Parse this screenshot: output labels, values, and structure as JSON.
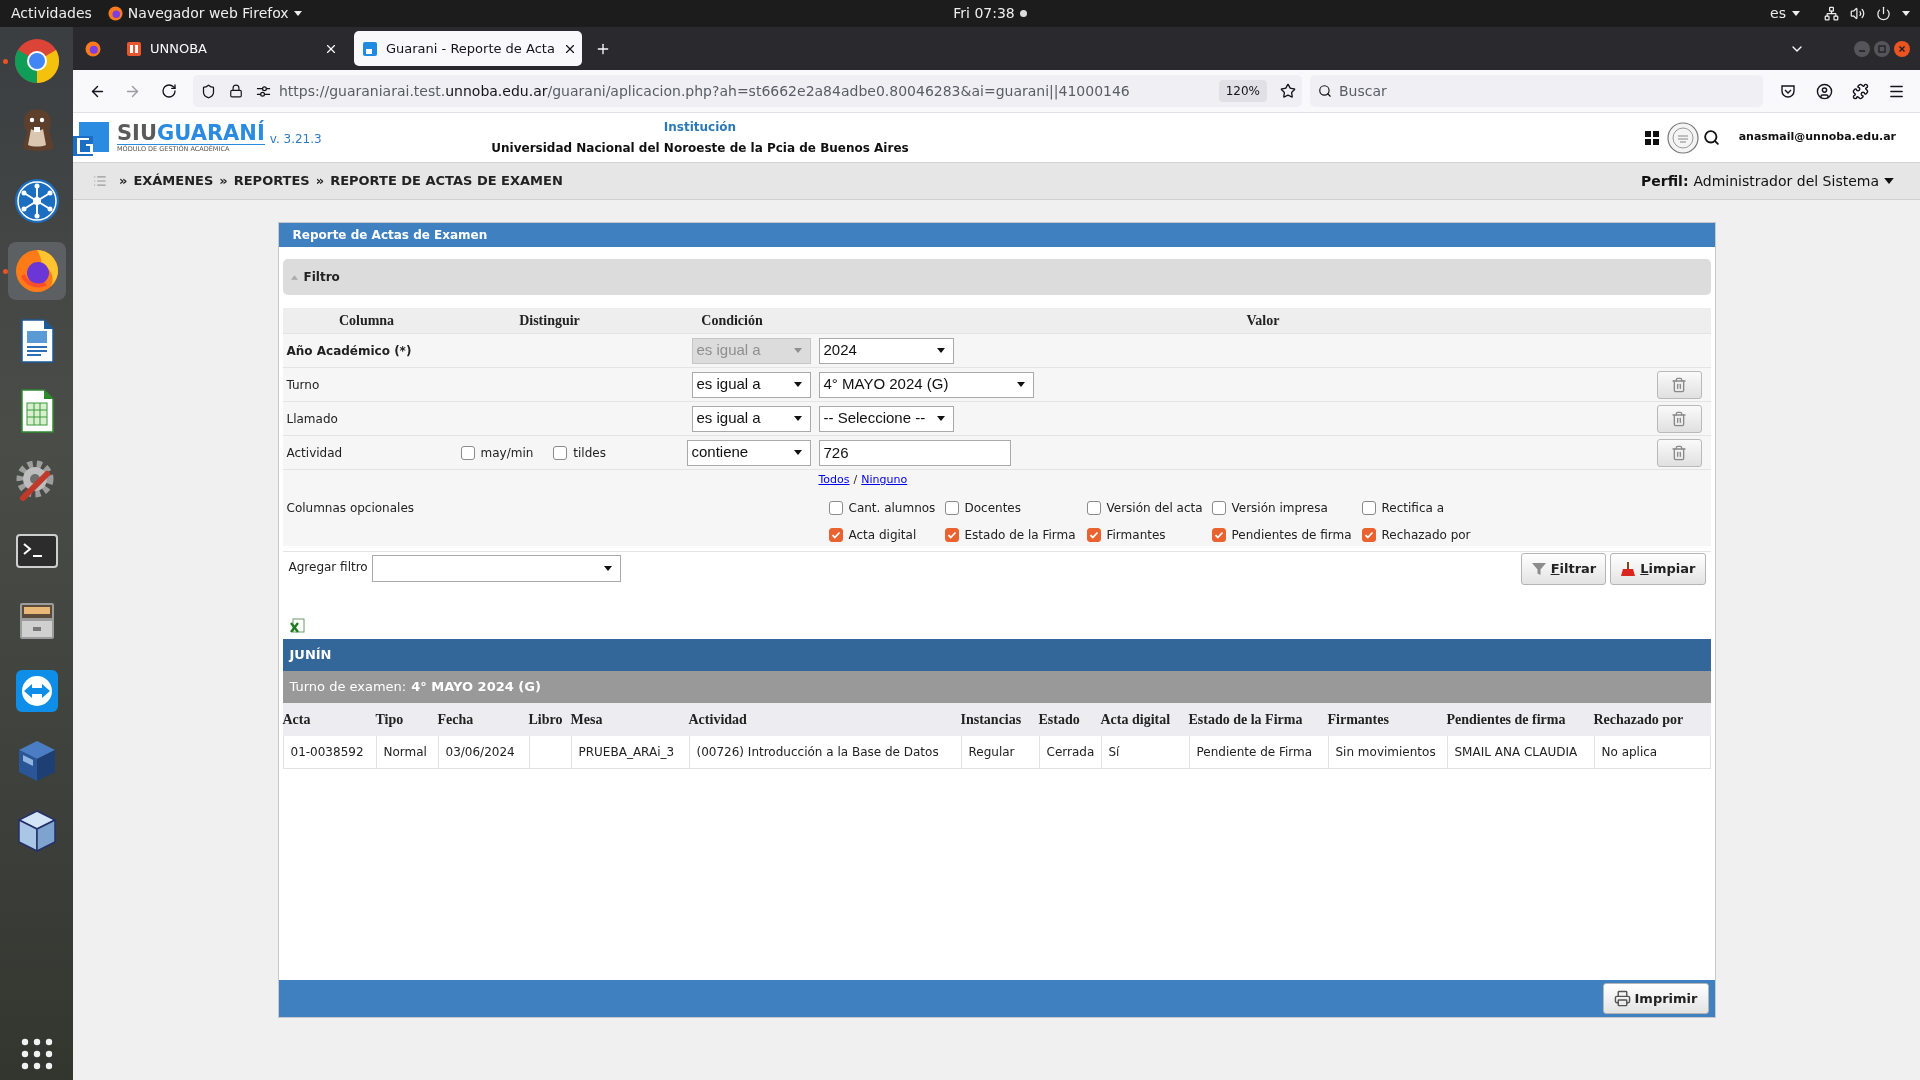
{
  "top_bar": {
    "activities": "Actividades",
    "app_menu": "Navegador web Firefox",
    "clock": "Fri 07:38",
    "language": "es"
  },
  "dock": [
    {
      "kind": "chrome",
      "running": true,
      "selected": false
    },
    {
      "kind": "beaver",
      "running": false,
      "selected": false
    },
    {
      "kind": "hub",
      "running": false,
      "selected": false
    },
    {
      "kind": "firefox",
      "running": true,
      "selected": true
    },
    {
      "kind": "writer",
      "running": false,
      "selected": false
    },
    {
      "kind": "calc",
      "running": false,
      "selected": false
    },
    {
      "kind": "tools",
      "running": false,
      "selected": false
    },
    {
      "kind": "terminal",
      "running": false,
      "selected": false
    },
    {
      "kind": "cabinet",
      "running": false,
      "selected": false
    },
    {
      "kind": "remote",
      "running": false,
      "selected": false
    },
    {
      "kind": "vbox",
      "running": false,
      "selected": false
    },
    {
      "kind": "cube",
      "running": false,
      "selected": false
    }
  ],
  "browser": {
    "tabs": [
      {
        "title": "UNNOBA",
        "selected": false
      },
      {
        "title": "Guarani - Reporte de Acta",
        "selected": true
      }
    ],
    "url": {
      "start": "https://guaraniarai.test.",
      "domain": "unnoba.edu.ar",
      "rest": "/guarani/aplicacion.php?ah=st6662e2a84adbe0.80046283&ai=guarani||41000146"
    },
    "zoom": "120%",
    "search": {
      "placeholder": "Buscar"
    }
  },
  "header": {
    "logo": {
      "first": "SIU",
      "second": "GUARANÍ",
      "tagline": "MÓDULO DE GESTIÓN ACADÉMICA"
    },
    "version": "v. 3.21.3",
    "institution_label": "Institución",
    "institution_name": "Universidad Nacional del Noroeste de la Pcia de Buenos Aires",
    "user": "anasmail@unnoba.edu.ar"
  },
  "breadcrumb": [
    {
      "separator": "»",
      "label": "EXÁMENES"
    },
    {
      "separator": "»",
      "label": "REPORTES"
    },
    {
      "separator": "»",
      "label": "REPORTE DE ACTAS DE EXAMEN"
    }
  ],
  "profile": {
    "label": "Perfil:",
    "value": "Administrador del Sistema"
  },
  "panel": {
    "title": "Reporte de Actas de Examen",
    "filter": {
      "title": "Filtro",
      "columns": [
        "Columna",
        "Distinguir",
        "Condición",
        "Valor"
      ],
      "rows": [
        {
          "kind": "select",
          "label": "Año Académico (*)",
          "required": true,
          "condition": "es igual a",
          "condition_disabled": true,
          "value": "2024",
          "removable": false
        },
        {
          "kind": "select",
          "label": "Turno",
          "required": false,
          "condition": "es igual a",
          "condition_disabled": false,
          "value": "4° MAYO 2024 (G)",
          "removable": true
        },
        {
          "kind": "select",
          "label": "Llamado",
          "required": false,
          "condition": "es igual a",
          "condition_disabled": false,
          "value": "-- Seleccione --",
          "removable": true
        },
        {
          "kind": "text",
          "label": "Actividad",
          "required": false,
          "options": [
            {
              "label": "may/min",
              "checked": false
            },
            {
              "label": "tildes",
              "checked": false
            }
          ],
          "condition": "contiene",
          "condition_disabled": false,
          "value": "726",
          "removable": true
        }
      ],
      "optional_columns": {
        "label": "Columnas opcionales",
        "links": [
          "Todos",
          "Ninguno"
        ],
        "link_separator": "/",
        "items": [
          {
            "label": "Cant. alumnos",
            "checked": false
          },
          {
            "label": "Docentes",
            "checked": false
          },
          {
            "label": "Versión del acta",
            "checked": false
          },
          {
            "label": "Versión impresa",
            "checked": false
          },
          {
            "label": "Rectifica a",
            "checked": false
          },
          {
            "label": "Acta digital",
            "checked": true
          },
          {
            "label": "Estado de la Firma",
            "checked": true
          },
          {
            "label": "Firmantes",
            "checked": true
          },
          {
            "label": "Pendientes de firma",
            "checked": true
          },
          {
            "label": "Rechazado por",
            "checked": true
          }
        ]
      },
      "add_filter": {
        "label": "Agregar filtro"
      },
      "buttons": [
        {
          "kind": "filter",
          "label": "Filtrar"
        },
        {
          "kind": "clear",
          "label": "Limpiar"
        }
      ]
    },
    "results": {
      "group": "JUNÍN",
      "turn_label": "Turno de examen:",
      "turn_value": "4° MAYO 2024 (G)",
      "columns": [
        "Acta",
        "Tipo",
        "Fecha",
        "Libro",
        "Mesa",
        "Actividad",
        "Instancias",
        "Estado",
        "Acta digital",
        "Estado de la Firma",
        "Firmantes",
        "Pendientes de firma",
        "Rechazado por"
      ],
      "rows": [
        [
          "01-0038592",
          "Normal",
          "03/06/2024",
          null,
          "PRUEBA_ARAi_3",
          "(00726) Introducción a la Base de Datos",
          "Regular",
          "Cerrada",
          "Sí",
          "Pendiente de Firma",
          "Sin movimientos",
          "SMAIL ANA CLAUDIA",
          "No aplica"
        ]
      ]
    },
    "footer": {
      "print": "Imprimir"
    }
  }
}
